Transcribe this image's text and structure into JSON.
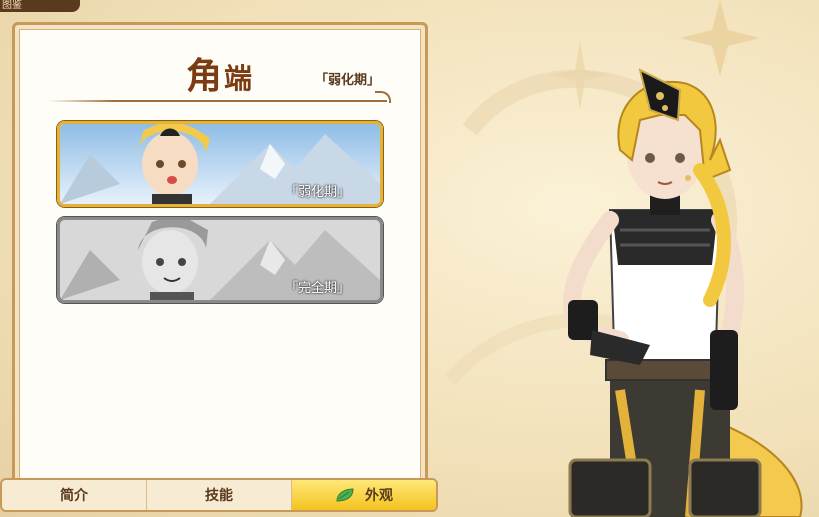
{
  "top_tab": {
    "label": "图鉴"
  },
  "panel": {
    "title_char1": "角",
    "title_char2": "端",
    "phase": "「弱化期」"
  },
  "forms": [
    {
      "label": "「弱化期」",
      "state": "selected"
    },
    {
      "label": "「完全期」",
      "state": "locked"
    }
  ],
  "tabs": [
    {
      "label": "简介",
      "active": false
    },
    {
      "label": "技能",
      "active": false
    },
    {
      "label": "外观",
      "active": true,
      "icon": "leaf-icon"
    }
  ],
  "colors": {
    "accent": "#f4c21e",
    "title": "#7a3c10",
    "frame": "#c89a5a"
  }
}
